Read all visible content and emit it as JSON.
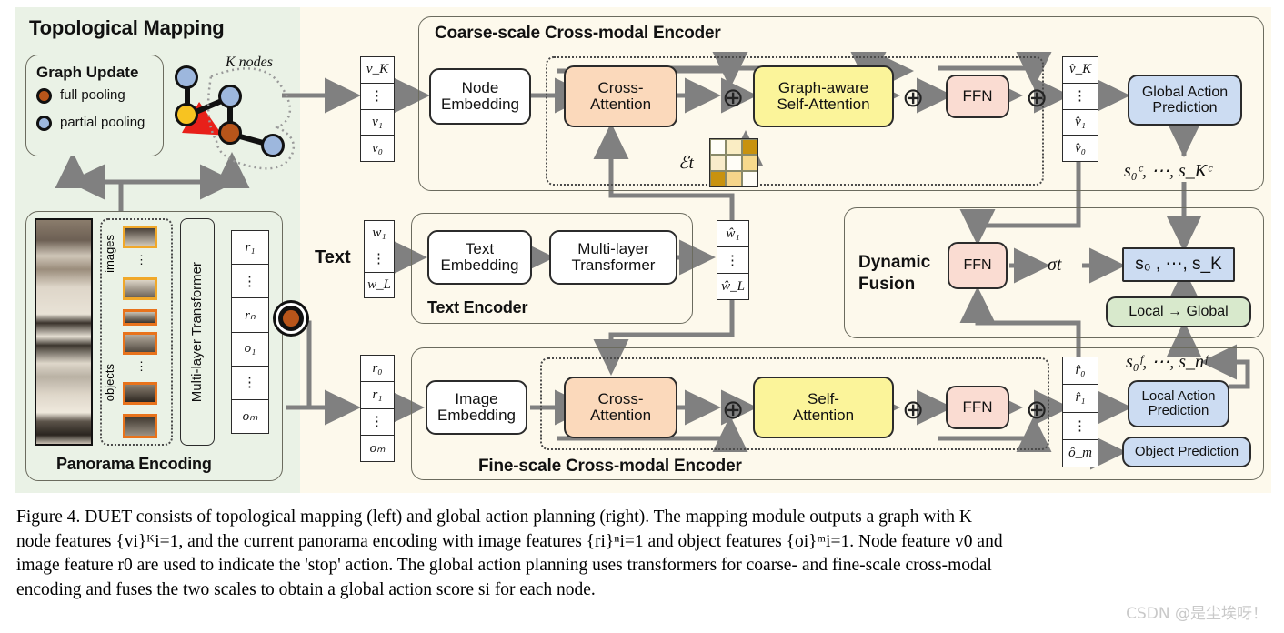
{
  "figure": {
    "caption_lines": [
      "Figure 4. DUET consists of topological mapping (left) and global action planning (right). The mapping module outputs a graph with K",
      "node features {vi}ᴷi=1, and the current panorama encoding with image features {ri}ⁿi=1 and object features {oi}ᵐi=1. Node feature v0 and",
      "image feature r0 are used to indicate the 'stop' action. The global action planning uses transformers for coarse- and fine-scale cross-modal",
      "encoding and fuses the two scales to obtain a global action score si for each node."
    ],
    "watermark": "CSDN @是尘埃呀！"
  },
  "topological_mapping": {
    "title": "Topological Mapping",
    "graph_update": {
      "title": "Graph Update",
      "legend": [
        {
          "label": "full pooling",
          "color": "#b8551a"
        },
        {
          "label": "partial pooling",
          "color": "#9db7dd"
        }
      ]
    },
    "k_nodes_label": "K nodes"
  },
  "panorama_encoding": {
    "title": "Panorama Encoding",
    "images_label": "images",
    "objects_label": "objects",
    "transformer_label": "Multi-layer Transformer",
    "output_stack": [
      "r₁",
      "⋮",
      "rₙ",
      "o₁",
      "⋮",
      "oₘ"
    ]
  },
  "coarse_encoder": {
    "title": "Coarse-scale Cross-modal Encoder",
    "input_stack": [
      "v_K",
      "⋮",
      "v₁",
      "v₀"
    ],
    "node_embedding": "Node\nEmbedding",
    "cross_attention": "Cross-\nAttention",
    "graph_self_attention": "Graph-aware\nSelf-Attention",
    "ffn": "FFN",
    "edge_matrix_label": "ℰt",
    "output_stack": [
      "v̂_K",
      "⋮",
      "v̂₁",
      "v̂₀"
    ],
    "global_action_prediction": "Global Action\nPrediction",
    "coarse_scores": "s₀ᶜ, ⋯, s_Kᶜ"
  },
  "text_encoder": {
    "text_label": "Text",
    "title": "Text Encoder",
    "input_stack": [
      "w₁",
      "⋮",
      "w_L"
    ],
    "text_embedding": "Text\nEmbedding",
    "multi_layer_transformer": "Multi-layer\nTransformer",
    "output_stack": [
      "ŵ₁",
      "⋮",
      "ŵ_L"
    ]
  },
  "fine_encoder": {
    "title": "Fine-scale Cross-modal Encoder",
    "input_stack": [
      "r₀",
      "r₁",
      "⋮",
      "oₘ"
    ],
    "image_embedding": "Image\nEmbedding",
    "cross_attention": "Cross-\nAttention",
    "self_attention": "Self-\nAttention",
    "ffn": "FFN",
    "output_stack": [
      "r̂₀",
      "r̂₁",
      "⋮",
      "ô_m"
    ],
    "local_action_prediction": "Local Action\nPrediction",
    "object_prediction": "Object Prediction",
    "fine_scores": "s₀ᶠ, ⋯, s_nᶠ"
  },
  "dynamic_fusion": {
    "title_line1": "Dynamic",
    "title_line2": "Fusion",
    "ffn": "FFN",
    "sigma": "σt",
    "fused_scores": "s₀ , ⋯, s_K",
    "local_to_global": "Local → Global"
  },
  "colors": {
    "cream_bg": "#fdf9ec",
    "green_bg": "#eaf2e6",
    "orange_block": "#fbd9bb",
    "yellow_block": "#fbf49a",
    "pink_block": "#fadcd2",
    "blue_block": "#ccdcf2",
    "green_block": "#d8e9cc",
    "wire": "#808080",
    "red_arrow": "#e8201a"
  }
}
